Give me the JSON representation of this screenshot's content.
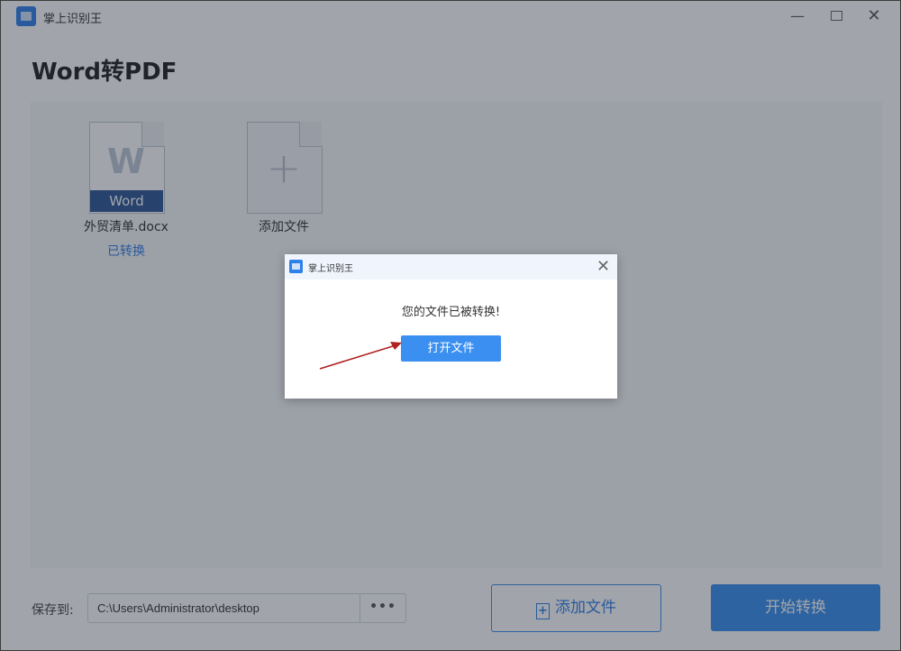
{
  "app": {
    "title": "掌上识别王"
  },
  "window_controls": {
    "minimize": "—",
    "close": "✕"
  },
  "page": {
    "title": "Word转PDF"
  },
  "files": [
    {
      "name": "外贸清单.docx",
      "status": "已转换",
      "type_badge": "Word",
      "glyph": "W",
      "icon": "word-doc-icon"
    },
    {
      "name": "添加文件",
      "icon": "add-file-placeholder-icon",
      "glyph": "+"
    }
  ],
  "bottom": {
    "save_label": "保存到:",
    "path": "C:\\Users\\Administrator\\desktop",
    "browse": "•••",
    "add_file": "添加文件",
    "start": "开始转换"
  },
  "dialog": {
    "title": "掌上识别王",
    "close": "✕",
    "message": "您的文件已被转换!",
    "open_button": "打开文件"
  },
  "colors": {
    "accent": "#3a8ff0",
    "status": "#2f80e8",
    "word_band": "#2b5797",
    "arrow": "#b02020"
  }
}
